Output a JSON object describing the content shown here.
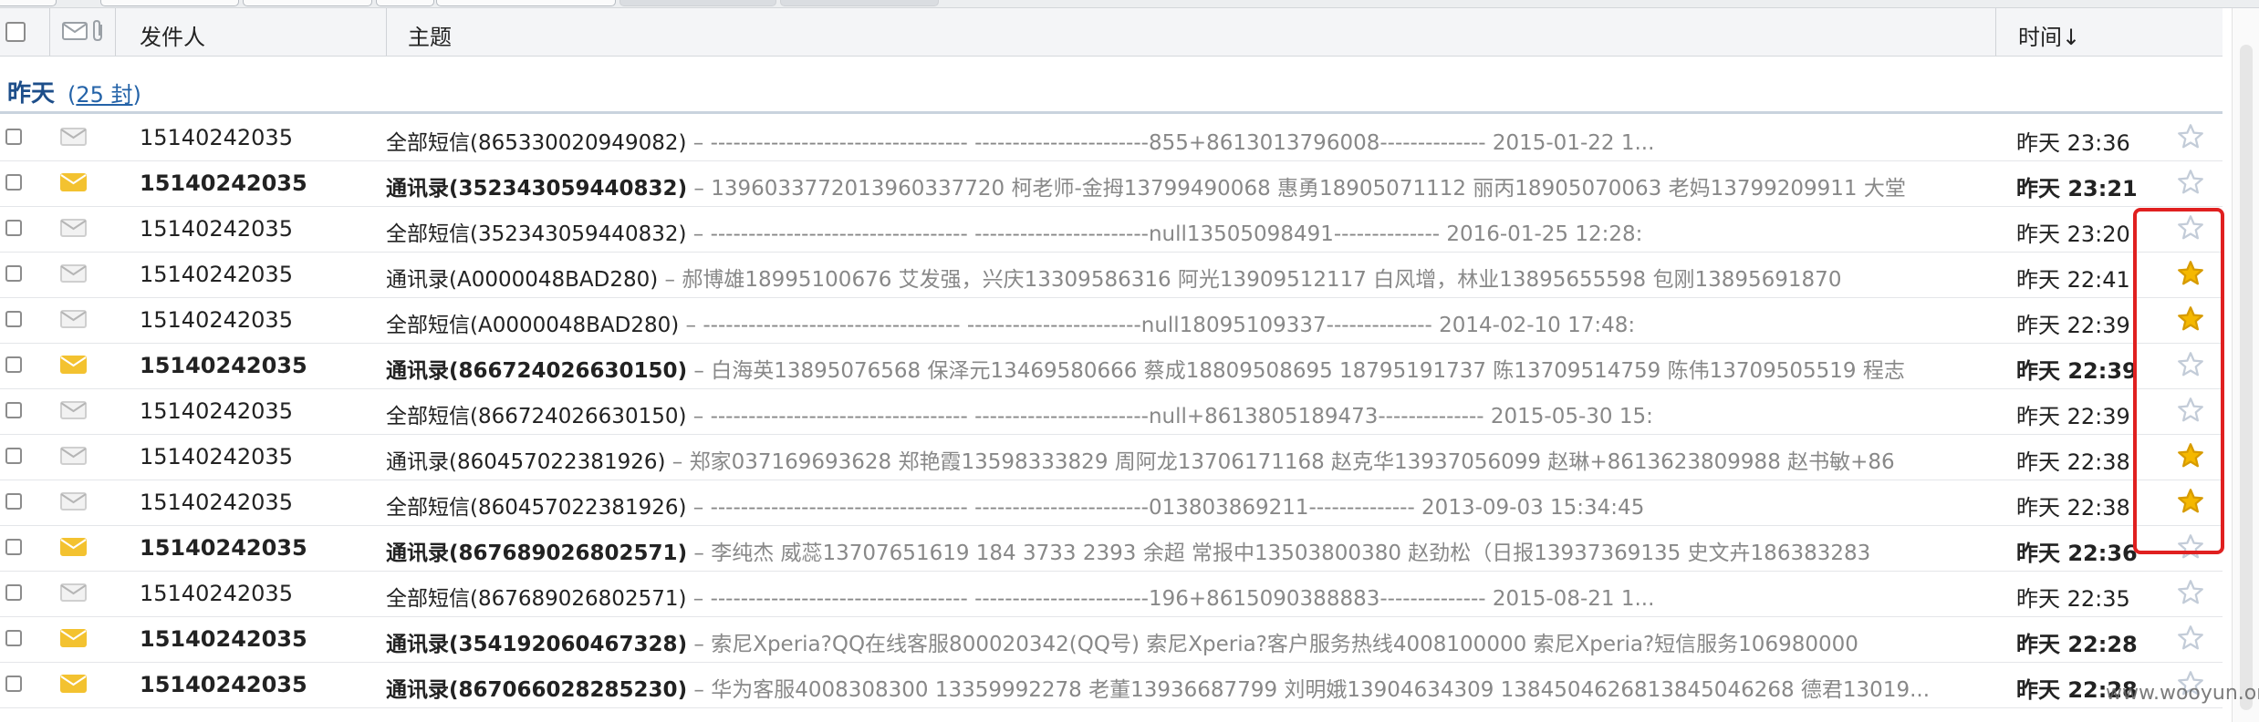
{
  "header": {
    "sender_label": "发件人",
    "subject_label": "主题",
    "time_label": "时间↓"
  },
  "group": {
    "title": "昨天",
    "count_open": "(",
    "count_link": "25 封",
    "count_close": ")"
  },
  "rows": [
    {
      "unread": false,
      "starred": false,
      "sender": "15140242035",
      "title": "全部短信(865330020949082)",
      "abstract": " – ---------------------------------- -----------------------855+8613013796008-------------- 2015-01-22 1...",
      "time": "昨天 23:36"
    },
    {
      "unread": true,
      "starred": false,
      "sender": "15140242035",
      "title": "通讯录(352343059440832)",
      "abstract": " – 13960337720​13960337720 柯老师-金拇13799490068 惠勇18905071112 丽丙18905070063 老妈13799209911 大堂",
      "time": "昨天 23:21"
    },
    {
      "unread": false,
      "starred": false,
      "sender": "15140242035",
      "title": "全部短信(352343059440832)",
      "abstract": " – ---------------------------------- -----------------------null13505098491-------------- 2016-01-25 12:28:",
      "time": "昨天 23:20"
    },
    {
      "unread": false,
      "starred": true,
      "sender": "15140242035",
      "title": "通讯录(A0000048BAD280)",
      "abstract": " – 郝博雄18995100676 艾发强，兴庆13309586316 阿光13909512117 白风增，林业13895655598 包刚13895691870",
      "time": "昨天 22:41"
    },
    {
      "unread": false,
      "starred": true,
      "sender": "15140242035",
      "title": "全部短信(A0000048BAD280)",
      "abstract": " – ---------------------------------- -----------------------null18095109337-------------- 2014-02-10 17:48:",
      "time": "昨天 22:39"
    },
    {
      "unread": true,
      "starred": false,
      "sender": "15140242035",
      "title": "通讯录(866724026630150)",
      "abstract": " – 白海英13895076568 保泽元13469580666 蔡成18809508695 18795191737 陈13709514759 陈伟13709505519 程志",
      "time": "昨天 22:39"
    },
    {
      "unread": false,
      "starred": false,
      "sender": "15140242035",
      "title": "全部短信(866724026630150)",
      "abstract": " – ---------------------------------- -----------------------null+8613805189473-------------- 2015-05-30 15:",
      "time": "昨天 22:39"
    },
    {
      "unread": false,
      "starred": true,
      "sender": "15140242035",
      "title": "通讯录(860457022381926)",
      "abstract": " – 郑家037169693628 郑艳霞13598333829 周阿龙13706171168 赵克华13937056099 赵琳+8613623809988 赵书敏+86",
      "time": "昨天 22:38"
    },
    {
      "unread": false,
      "starred": true,
      "sender": "15140242035",
      "title": "全部短信(860457022381926)",
      "abstract": " – ---------------------------------- -----------------------013803869211-------------- 2013-09-03 15:34:45",
      "time": "昨天 22:38"
    },
    {
      "unread": true,
      "starred": false,
      "sender": "15140242035",
      "title": "通讯录(867689026802571)",
      "abstract": " – 李纯杰 威蕊13707651619 184 3733 2393 余超 常报中13503800380 赵劲松（日报13937369135 史文卉186383283",
      "time": "昨天 22:36"
    },
    {
      "unread": false,
      "starred": false,
      "sender": "15140242035",
      "title": "全部短信(867689026802571)",
      "abstract": " – ---------------------------------- -----------------------196+8615090388883-------------- 2015-08-21 1...",
      "time": "昨天 22:35"
    },
    {
      "unread": true,
      "starred": false,
      "sender": "15140242035",
      "title": "通讯录(354192060467328)",
      "abstract": " – 索尼Xperia?QQ在线客服800020342(QQ号) 索尼Xperia?客户服务热线4008100000 索尼Xperia?短信服务106980000",
      "time": "昨天 22:28"
    },
    {
      "unread": true,
      "starred": false,
      "sender": "15140242035",
      "title": "通讯录(867066028285230)",
      "abstract": " – 华为客服4008308300 13359992278 老董13936687799 刘明娥13904634309 13845046268​13845046268 德君13019...",
      "time": "昨天 22:28"
    }
  ],
  "watermark": "www.wooyun.org",
  "colors": {
    "read_envelope": "#cfcfcf",
    "unread_envelope": "#f3c230",
    "star_on": "#f5b800",
    "star_off": "#c3ccd8",
    "highlight": "#e02020"
  }
}
